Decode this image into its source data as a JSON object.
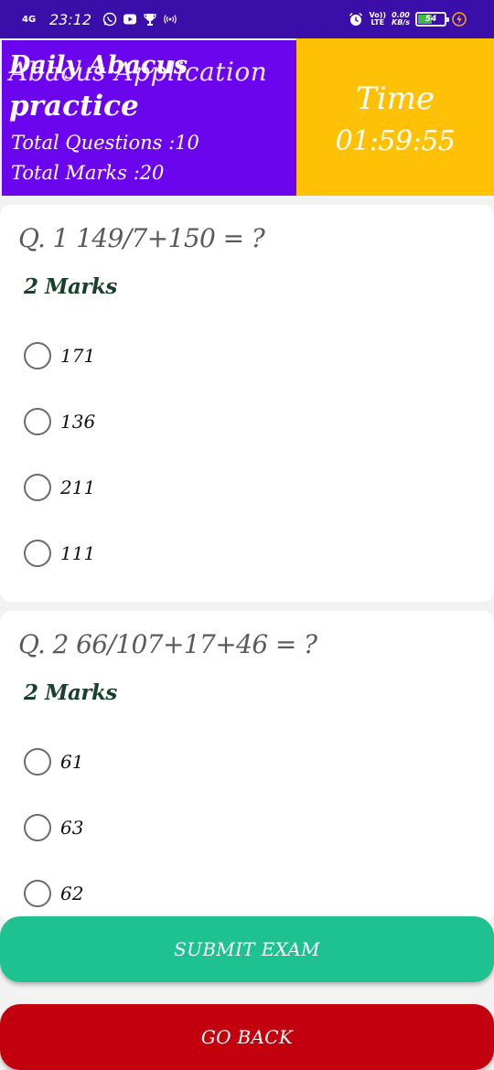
{
  "status_bar": {
    "network": "4G",
    "time": "23:12",
    "icons": [
      "whatsapp-icon",
      "youtube-icon",
      "trophy-icon",
      "hotspot-icon"
    ],
    "volte": "Vo))",
    "lte": "LTE",
    "speed_value": "0.00",
    "speed_unit": "KB/s",
    "battery_level": "54",
    "battery_fraction": 0.54,
    "charging": true
  },
  "header": {
    "title_overlap_back": "Abacus Application",
    "title_overlap_front": "Daily Abacus",
    "title_line2": "practice",
    "total_questions": "Total Questions :10",
    "total_marks": "Total Marks :20",
    "time_label": "Time",
    "time_value": "01:59:55",
    "colors": {
      "left_bg": "#6a05ee",
      "right_bg": "#ffc106"
    }
  },
  "questions": [
    {
      "title": "Q. 1 149/7+150 = ?",
      "marks": "2 Marks",
      "options": [
        "171",
        "136",
        "211",
        "111"
      ]
    },
    {
      "title": "Q. 2 66/107+17+46 = ?",
      "marks": "2 Marks",
      "options": [
        "61",
        "63",
        "62"
      ]
    }
  ],
  "actions": {
    "submit": "SUBMIT EXAM",
    "back": "GO BACK",
    "colors": {
      "submit": "#1ec190",
      "back": "#c3000e"
    }
  }
}
